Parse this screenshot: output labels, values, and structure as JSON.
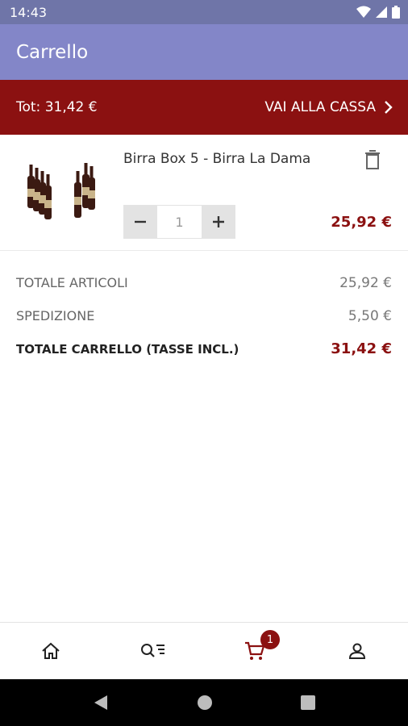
{
  "status_bar": {
    "time": "14:43"
  },
  "app_bar": {
    "title": "Carrello"
  },
  "checkout_bar": {
    "total": "Tot: 31,42 €",
    "checkout_label": "VAI ALLA CASSA"
  },
  "cart_items": [
    {
      "name": "Birra Box 5 - Birra La Dama",
      "quantity": "1",
      "price": "25,92 €"
    }
  ],
  "summary": {
    "items_label": "TOTALE ARTICOLI",
    "items_value": "25,92 €",
    "shipping_label": "SPEDIZIONE",
    "shipping_value": "5,50 €",
    "total_label": "TOTALE CARRELLO (TASSE INCL.)",
    "total_value": "31,42 €"
  },
  "bottom_nav": {
    "items": [
      "home-icon",
      "search-list-icon",
      "cart-icon",
      "account-icon"
    ],
    "cart_badge": "1",
    "active": "cart"
  },
  "colors": {
    "accent": "#8b1111",
    "app_bar": "#8386c8",
    "status_bar": "#6f75a8"
  }
}
